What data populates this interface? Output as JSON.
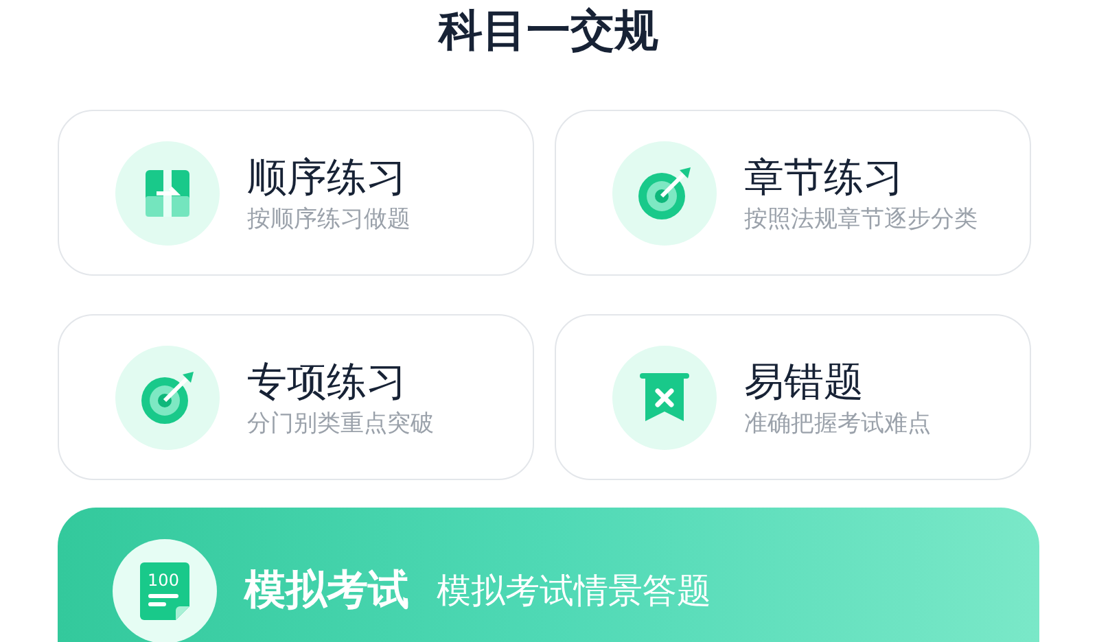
{
  "title": "科目一交规",
  "modes": [
    {
      "kind": "list",
      "name": "顺序练习",
      "desc": "按顺序练习做题"
    },
    {
      "kind": "target",
      "name": "章节练习",
      "desc": "按照法规章节逐步分类"
    },
    {
      "kind": "target",
      "name": "专项练习",
      "desc": "分门别类重点突破"
    },
    {
      "kind": "bookmark",
      "name": "易错题",
      "desc": "准确把握考试难点"
    }
  ],
  "exam": {
    "icon_text": "100",
    "name": "模拟考试",
    "desc": "模拟考试情景答题"
  }
}
